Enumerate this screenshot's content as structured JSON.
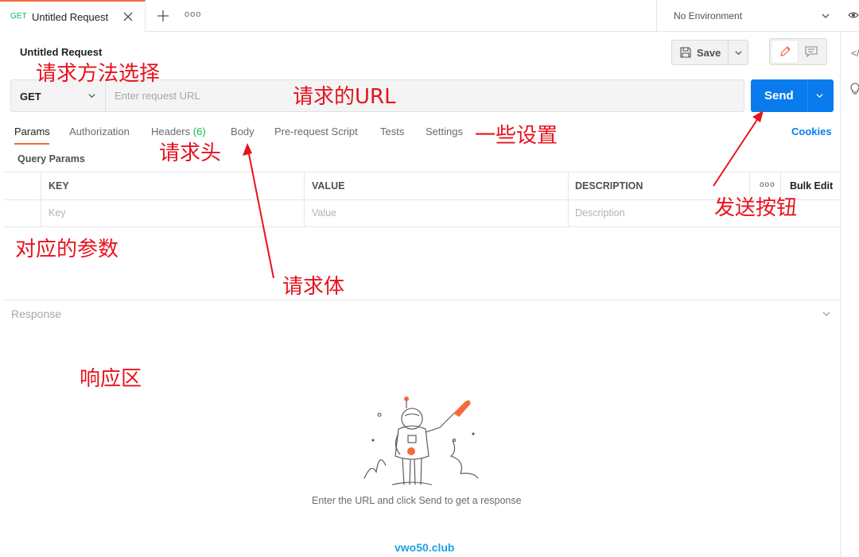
{
  "tabs": [
    {
      "method": "GET",
      "title": "Untitled Request"
    }
  ],
  "tab_bar": {
    "more": "ooo"
  },
  "environment": {
    "label": "No Environment"
  },
  "request": {
    "title": "Untitled Request",
    "save_label": "Save",
    "method": "GET",
    "url_placeholder": "Enter request URL",
    "send_label": "Send"
  },
  "request_tabs": {
    "params": "Params",
    "authorization": "Authorization",
    "headers": "Headers",
    "headers_count": "(6)",
    "body": "Body",
    "pre_request_script": "Pre-request Script",
    "tests": "Tests",
    "settings": "Settings",
    "cookies": "Cookies"
  },
  "params": {
    "section_label": "Query Params",
    "columns": [
      "KEY",
      "VALUE",
      "DESCRIPTION"
    ],
    "more": "ooo",
    "bulk_edit": "Bulk Edit",
    "placeholders": [
      "Key",
      "Value",
      "Description"
    ]
  },
  "response": {
    "label": "Response",
    "empty_text": "Enter the URL and click Send to get a response"
  },
  "watermark": "vwo50.club",
  "annotations": {
    "method": "请求方法选择",
    "url": "请求的URL",
    "settings": "一些设置",
    "headers": "请求头",
    "send": "发送按钮",
    "params": "对应的参数",
    "body": "请求体",
    "response": "响应区"
  },
  "colors": {
    "accent": "#f26b3a",
    "send": "#097bed",
    "method_get": "#0cbb52",
    "annotation": "#e8121c",
    "watermark": "#1ea1e8"
  }
}
